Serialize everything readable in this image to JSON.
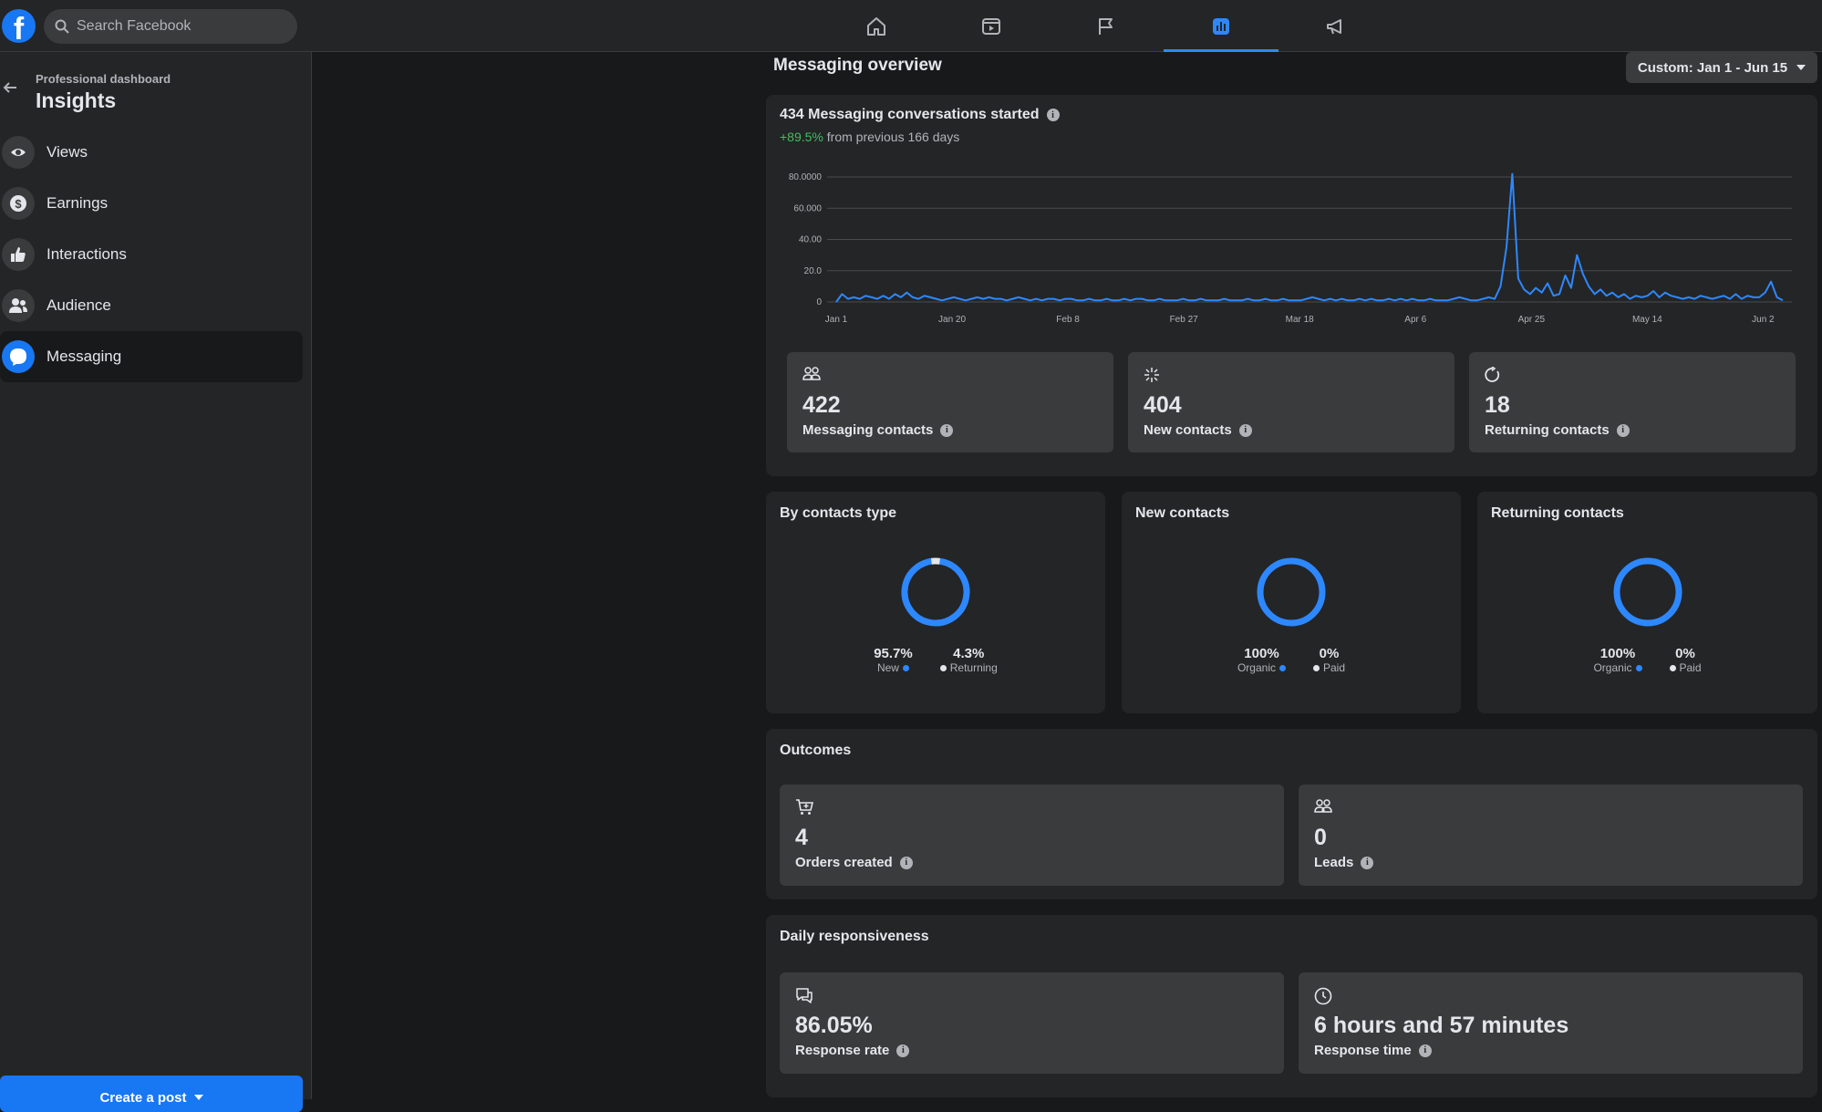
{
  "topbar": {
    "search_placeholder": "Search Facebook",
    "nav_tabs": [
      "home-icon",
      "video-icon",
      "flag-icon",
      "insights-icon",
      "megaphone-icon"
    ],
    "active_tab": 3
  },
  "sidebar": {
    "subtitle": "Professional dashboard",
    "title": "Insights",
    "items": [
      {
        "label": "Views",
        "icon": "eye-icon"
      },
      {
        "label": "Earnings",
        "icon": "dollar-icon"
      },
      {
        "label": "Interactions",
        "icon": "thumbs-up-icon"
      },
      {
        "label": "Audience",
        "icon": "people-icon"
      },
      {
        "label": "Messaging",
        "icon": "messenger-icon"
      }
    ],
    "active_item": 4,
    "create_post": "Create a post"
  },
  "overview": {
    "title": "Messaging overview",
    "date_range": "Custom: Jan 1 - Jun 15"
  },
  "conversations": {
    "title": "434 Messaging conversations started",
    "change": "+89.5%",
    "change_suffix": "from previous 166 days"
  },
  "chart_data": {
    "type": "line",
    "title": "",
    "xlabel": "",
    "ylabel": "",
    "y_ticks": [
      "0",
      "20.0",
      "40.00",
      "60.000",
      "80.0000"
    ],
    "ylim": [
      0,
      80
    ],
    "x_ticks": [
      "Jan 1",
      "Jan 20",
      "Feb 8",
      "Feb 27",
      "Mar 18",
      "Apr 6",
      "Apr 25",
      "May 14",
      "Jun 2"
    ],
    "grid": true,
    "color": "#2d88ff",
    "series": [
      {
        "values": [
          0,
          5,
          2,
          3,
          2,
          4,
          3,
          2,
          4,
          2,
          5,
          3,
          6,
          3,
          2,
          4,
          3,
          2,
          1,
          2,
          3,
          2,
          1,
          2,
          3,
          2,
          3,
          2,
          2,
          1,
          2,
          3,
          2,
          1,
          2,
          1,
          2,
          2,
          1,
          2,
          2,
          1,
          1,
          2,
          1,
          1,
          2,
          1,
          1,
          2,
          1,
          2,
          2,
          1,
          1,
          2,
          1,
          1,
          1,
          2,
          1,
          1,
          2,
          1,
          1,
          1,
          2,
          1,
          1,
          1,
          2,
          1,
          1,
          2,
          1,
          1,
          2,
          1,
          1,
          1,
          2,
          3,
          2,
          1,
          2,
          1,
          2,
          1,
          1,
          2,
          1,
          2,
          1,
          1,
          2,
          1,
          2,
          1,
          2,
          1,
          1,
          2,
          1,
          1,
          1,
          2,
          3,
          2,
          1,
          1,
          2,
          3,
          2,
          10,
          35,
          82,
          15,
          8,
          5,
          9,
          6,
          12,
          4,
          5,
          17,
          9,
          30,
          18,
          10,
          5,
          8,
          4,
          6,
          3,
          5,
          2,
          4,
          3,
          4,
          7,
          3,
          6,
          4,
          3,
          2,
          3,
          2,
          4,
          3,
          2,
          3,
          4,
          2,
          5,
          2,
          4,
          3,
          3,
          6,
          13,
          3,
          1
        ]
      }
    ]
  },
  "stats_top": [
    {
      "value": "422",
      "label": "Messaging contacts",
      "icon": "people-icon"
    },
    {
      "value": "404",
      "label": "New contacts",
      "icon": "sparkle-icon"
    },
    {
      "value": "18",
      "label": "Returning contacts",
      "icon": "refresh-icon"
    }
  ],
  "donuts": [
    {
      "title": "By contacts type",
      "a_pct": "95.7%",
      "a_name": "New",
      "b_pct": "4.3%",
      "b_name": "Returning",
      "a_value": 95.7,
      "b_value": 4.3
    },
    {
      "title": "New contacts",
      "a_pct": "100%",
      "a_name": "Organic",
      "b_pct": "0%",
      "b_name": "Paid",
      "a_value": 100,
      "b_value": 0
    },
    {
      "title": "Returning contacts",
      "a_pct": "100%",
      "a_name": "Organic",
      "b_pct": "0%",
      "b_name": "Paid",
      "a_value": 100,
      "b_value": 0
    }
  ],
  "outcomes": {
    "title": "Outcomes",
    "items": [
      {
        "value": "4",
        "label": "Orders created",
        "icon": "cart-icon"
      },
      {
        "value": "0",
        "label": "Leads",
        "icon": "people-icon"
      }
    ]
  },
  "responsiveness": {
    "title": "Daily responsiveness",
    "items": [
      {
        "value": "86.05%",
        "label": "Response rate",
        "icon": "chat-icon"
      },
      {
        "value": "6 hours and 57 minutes",
        "label": "Response time",
        "icon": "clock-icon"
      }
    ]
  },
  "colors": {
    "accent": "#1877f2",
    "positive": "#45bd62",
    "line": "#2d88ff"
  }
}
